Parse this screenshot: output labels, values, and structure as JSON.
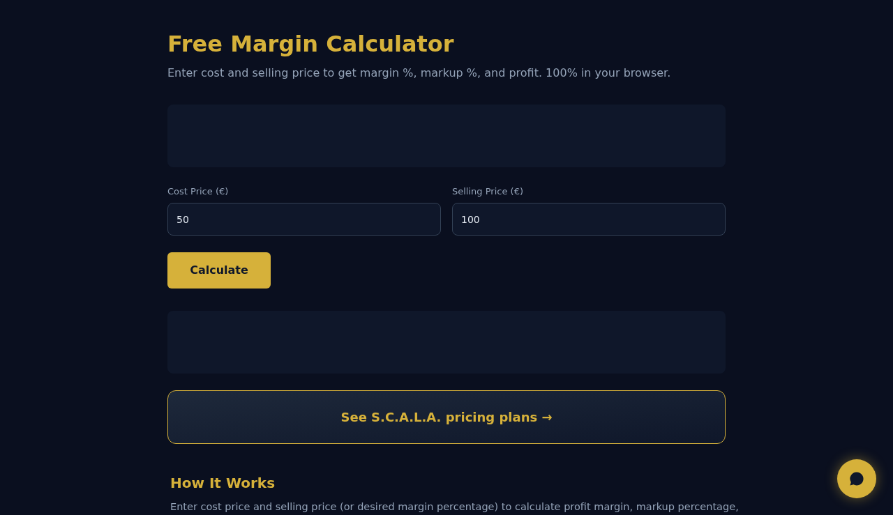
{
  "header": {
    "title": "Free Margin Calculator",
    "subtitle": "Enter cost and selling price to get margin %, markup %, and profit. 100% in your browser."
  },
  "fields": [
    {
      "label": "Cost Price (€)",
      "value": "50"
    },
    {
      "label": "Selling Price (€)",
      "value": "100"
    }
  ],
  "calculate_button": "Calculate",
  "pricing_link": "See S.C.A.L.A. pricing plans →",
  "how_it_works": {
    "title": "How It Works",
    "text": "Enter cost price and selling price (or desired margin percentage) to calculate profit margin, markup percentage,"
  }
}
